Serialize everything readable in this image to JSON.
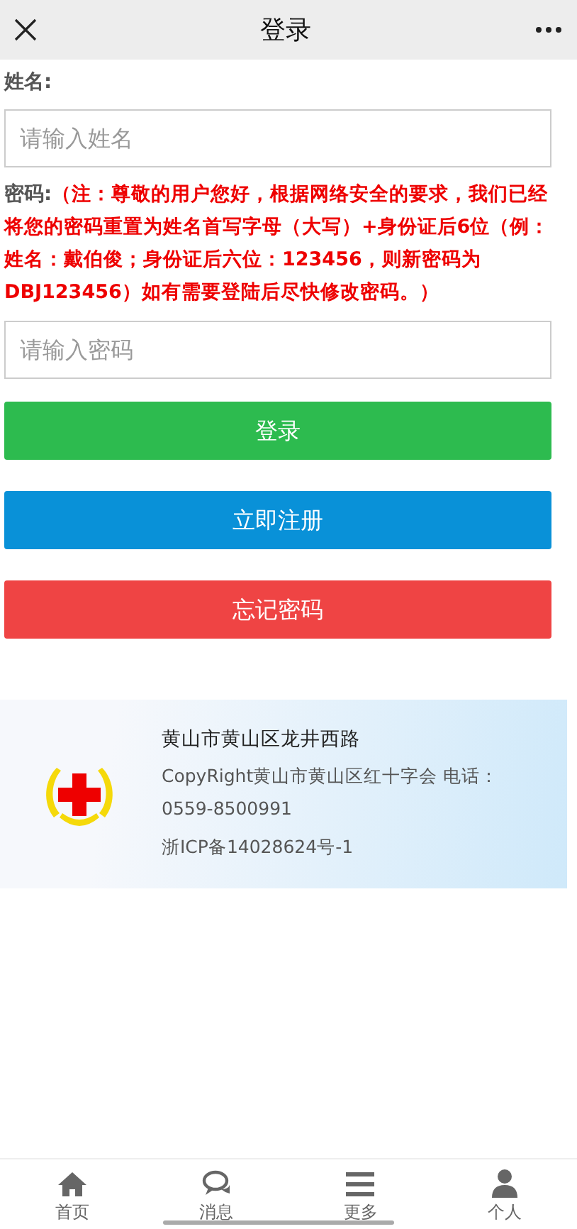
{
  "header": {
    "title": "登录"
  },
  "form": {
    "name_label": "姓名:",
    "name_placeholder": "请输入姓名",
    "password_label": "密码:",
    "password_note": "（注：尊敬的用户您好，根据网络安全的要求，我们已经将您的密码重置为姓名首写字母（大写）+身份证后6位（例：姓名：戴伯俊；身份证后六位：123456，则新密码为DBJ123456）如有需要登陆后尽快修改密码。）",
    "password_placeholder": "请输入密码"
  },
  "buttons": [
    {
      "label": "登录",
      "kind": "success"
    },
    {
      "label": "立即注册",
      "kind": "primary"
    },
    {
      "label": "忘记密码",
      "kind": "danger"
    }
  ],
  "footer": {
    "address": "黄山市黄山区龙井西路",
    "copyright": "CopyRight黄山市黄山区红十字会 电话：0559-8500991",
    "icp": "浙ICP备14028624号-1"
  },
  "tabbar": [
    {
      "label": "首页",
      "kind": "home"
    },
    {
      "label": "消息",
      "kind": "chat"
    },
    {
      "label": "更多",
      "kind": "menu"
    },
    {
      "label": "个人",
      "kind": "user"
    }
  ]
}
